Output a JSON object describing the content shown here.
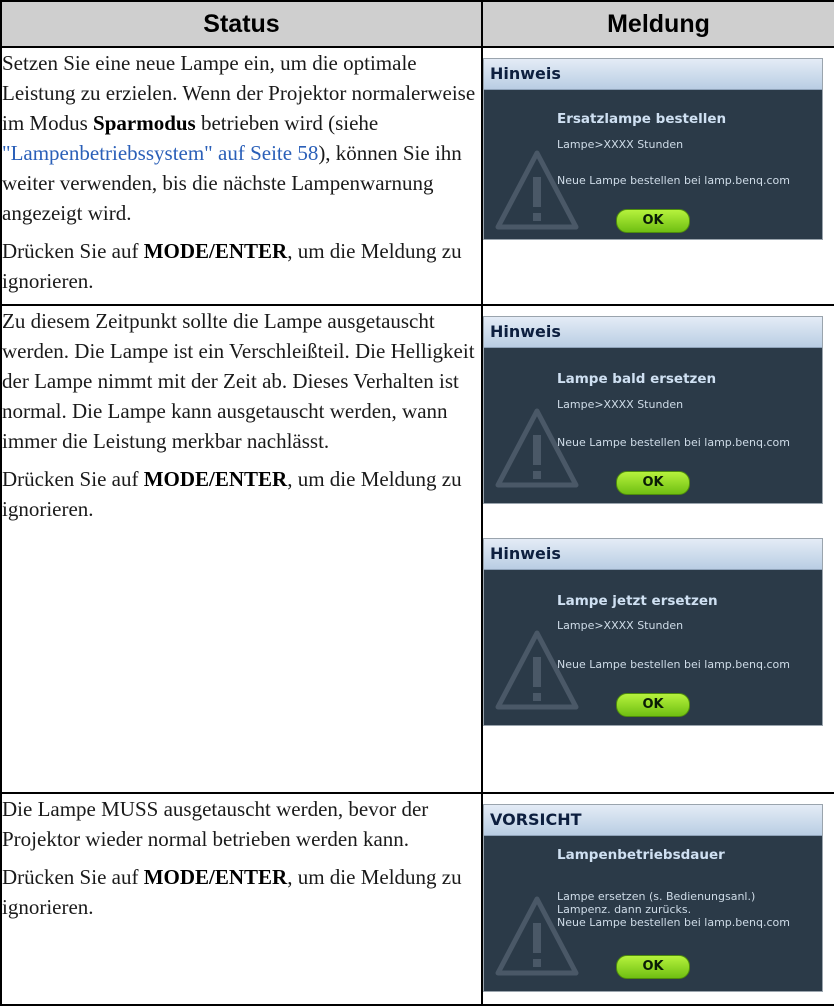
{
  "headers": {
    "status": "Status",
    "meldung": "Meldung"
  },
  "rows": [
    {
      "p1_a": "Setzen Sie eine neue Lampe ein, um die optimale Leistung zu erzielen. Wenn der Projektor normalerweise im Modus ",
      "p1_bold": "Sparmodus",
      "p1_b": " betrieben wird (siehe ",
      "p1_link": "\"Lampenbetriebssystem\" auf Seite 58",
      "p1_c": "), können Sie ihn weiter verwenden, bis die nächste Lampenwarnung angezeigt wird.",
      "p2_a": "Drücken Sie auf ",
      "p2_bold": "MODE/ENTER",
      "p2_b": ", um die Meldung zu ignorieren.",
      "dialogs": [
        {
          "header": "Hinweis",
          "title": "Ersatzlampe bestellen",
          "line1": "Lampe>XXXX Stunden",
          "line2": "Neue Lampe bestellen bei lamp.benq.com",
          "ok": "OK"
        }
      ]
    },
    {
      "p1": "Zu diesem Zeitpunkt sollte die Lampe ausgetauscht werden. Die Lampe ist ein Verschleißteil. Die Helligkeit der Lampe nimmt mit der Zeit ab. Dieses Verhalten ist normal. Die Lampe kann ausgetauscht werden, wann immer die Leistung merkbar nachlässt.",
      "p2_a": "Drücken Sie auf ",
      "p2_bold": "MODE/ENTER",
      "p2_b": ", um die Meldung zu ignorieren.",
      "dialogs": [
        {
          "header": "Hinweis",
          "title": "Lampe bald ersetzen",
          "line1": "Lampe>XXXX Stunden",
          "line2": "Neue Lampe bestellen bei lamp.benq.com",
          "ok": "OK"
        },
        {
          "header": "Hinweis",
          "title": "Lampe jetzt ersetzen",
          "line1": "Lampe>XXXX Stunden",
          "line2": "Neue Lampe bestellen bei lamp.benq.com",
          "ok": "OK"
        }
      ]
    },
    {
      "p1": "Die Lampe MUSS ausgetauscht werden, bevor der Projektor wieder normal betrieben werden kann.",
      "p2_a": "Drücken Sie auf ",
      "p2_bold": "MODE/ENTER",
      "p2_b": ", um die Meldung zu ignorieren.",
      "dialogs": [
        {
          "header": "VORSICHT",
          "title": "Lampenbetriebsdauer",
          "line1": "Lampe ersetzen (s. Bedienungsanl.)",
          "line2": "Lampenz. dann zurücks.",
          "line3": "Neue Lampe bestellen bei lamp.benq.com",
          "ok": "OK"
        }
      ]
    }
  ]
}
